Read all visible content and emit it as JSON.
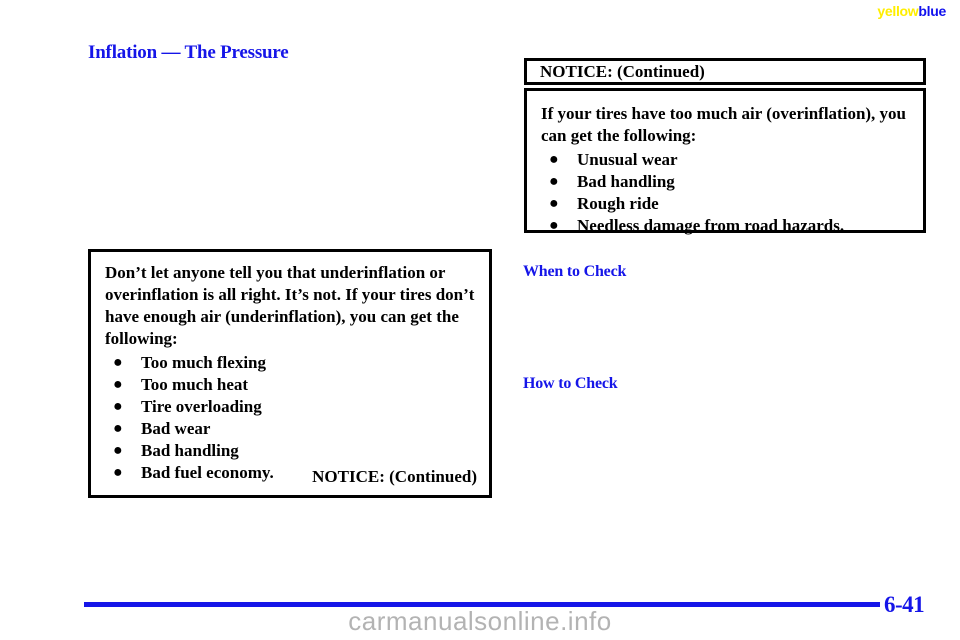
{
  "watermark": {
    "top_part1": "yellow",
    "top_part2": "blue",
    "bottom": "carmanualsonline.info",
    "yellow_color": "#ffee00",
    "blue_color": "#1111ee",
    "bottom_color": "#b3b3b3"
  },
  "page": {
    "heading": "Inflation — The Pressure",
    "heading_color": "#1515e8",
    "page_number": "6-41",
    "rule_color": "#1515e8"
  },
  "sections": {
    "when_to_check": "When to Check",
    "how_to_check": "How to Check"
  },
  "notice_left": {
    "paragraph": "Don’t let anyone tell you that underinflation or overinflation is all right. It’s not. If your tires don’t have enough air (underinflation), you can get the following:",
    "bullet_glyph": "●",
    "bullets": [
      "Too much flexing",
      "Too much heat",
      "Tire overloading",
      "Bad wear",
      "Bad handling",
      "Bad fuel economy."
    ],
    "continued_label": "NOTICE: (Continued)"
  },
  "notice_right": {
    "title": "NOTICE: (Continued)",
    "paragraph": "If your tires have too much air (overinflation), you can get the following:",
    "bullet_glyph": "●",
    "bullets": [
      "Unusual wear",
      "Bad handling",
      "Rough ride",
      "Needless damage from road hazards."
    ]
  }
}
